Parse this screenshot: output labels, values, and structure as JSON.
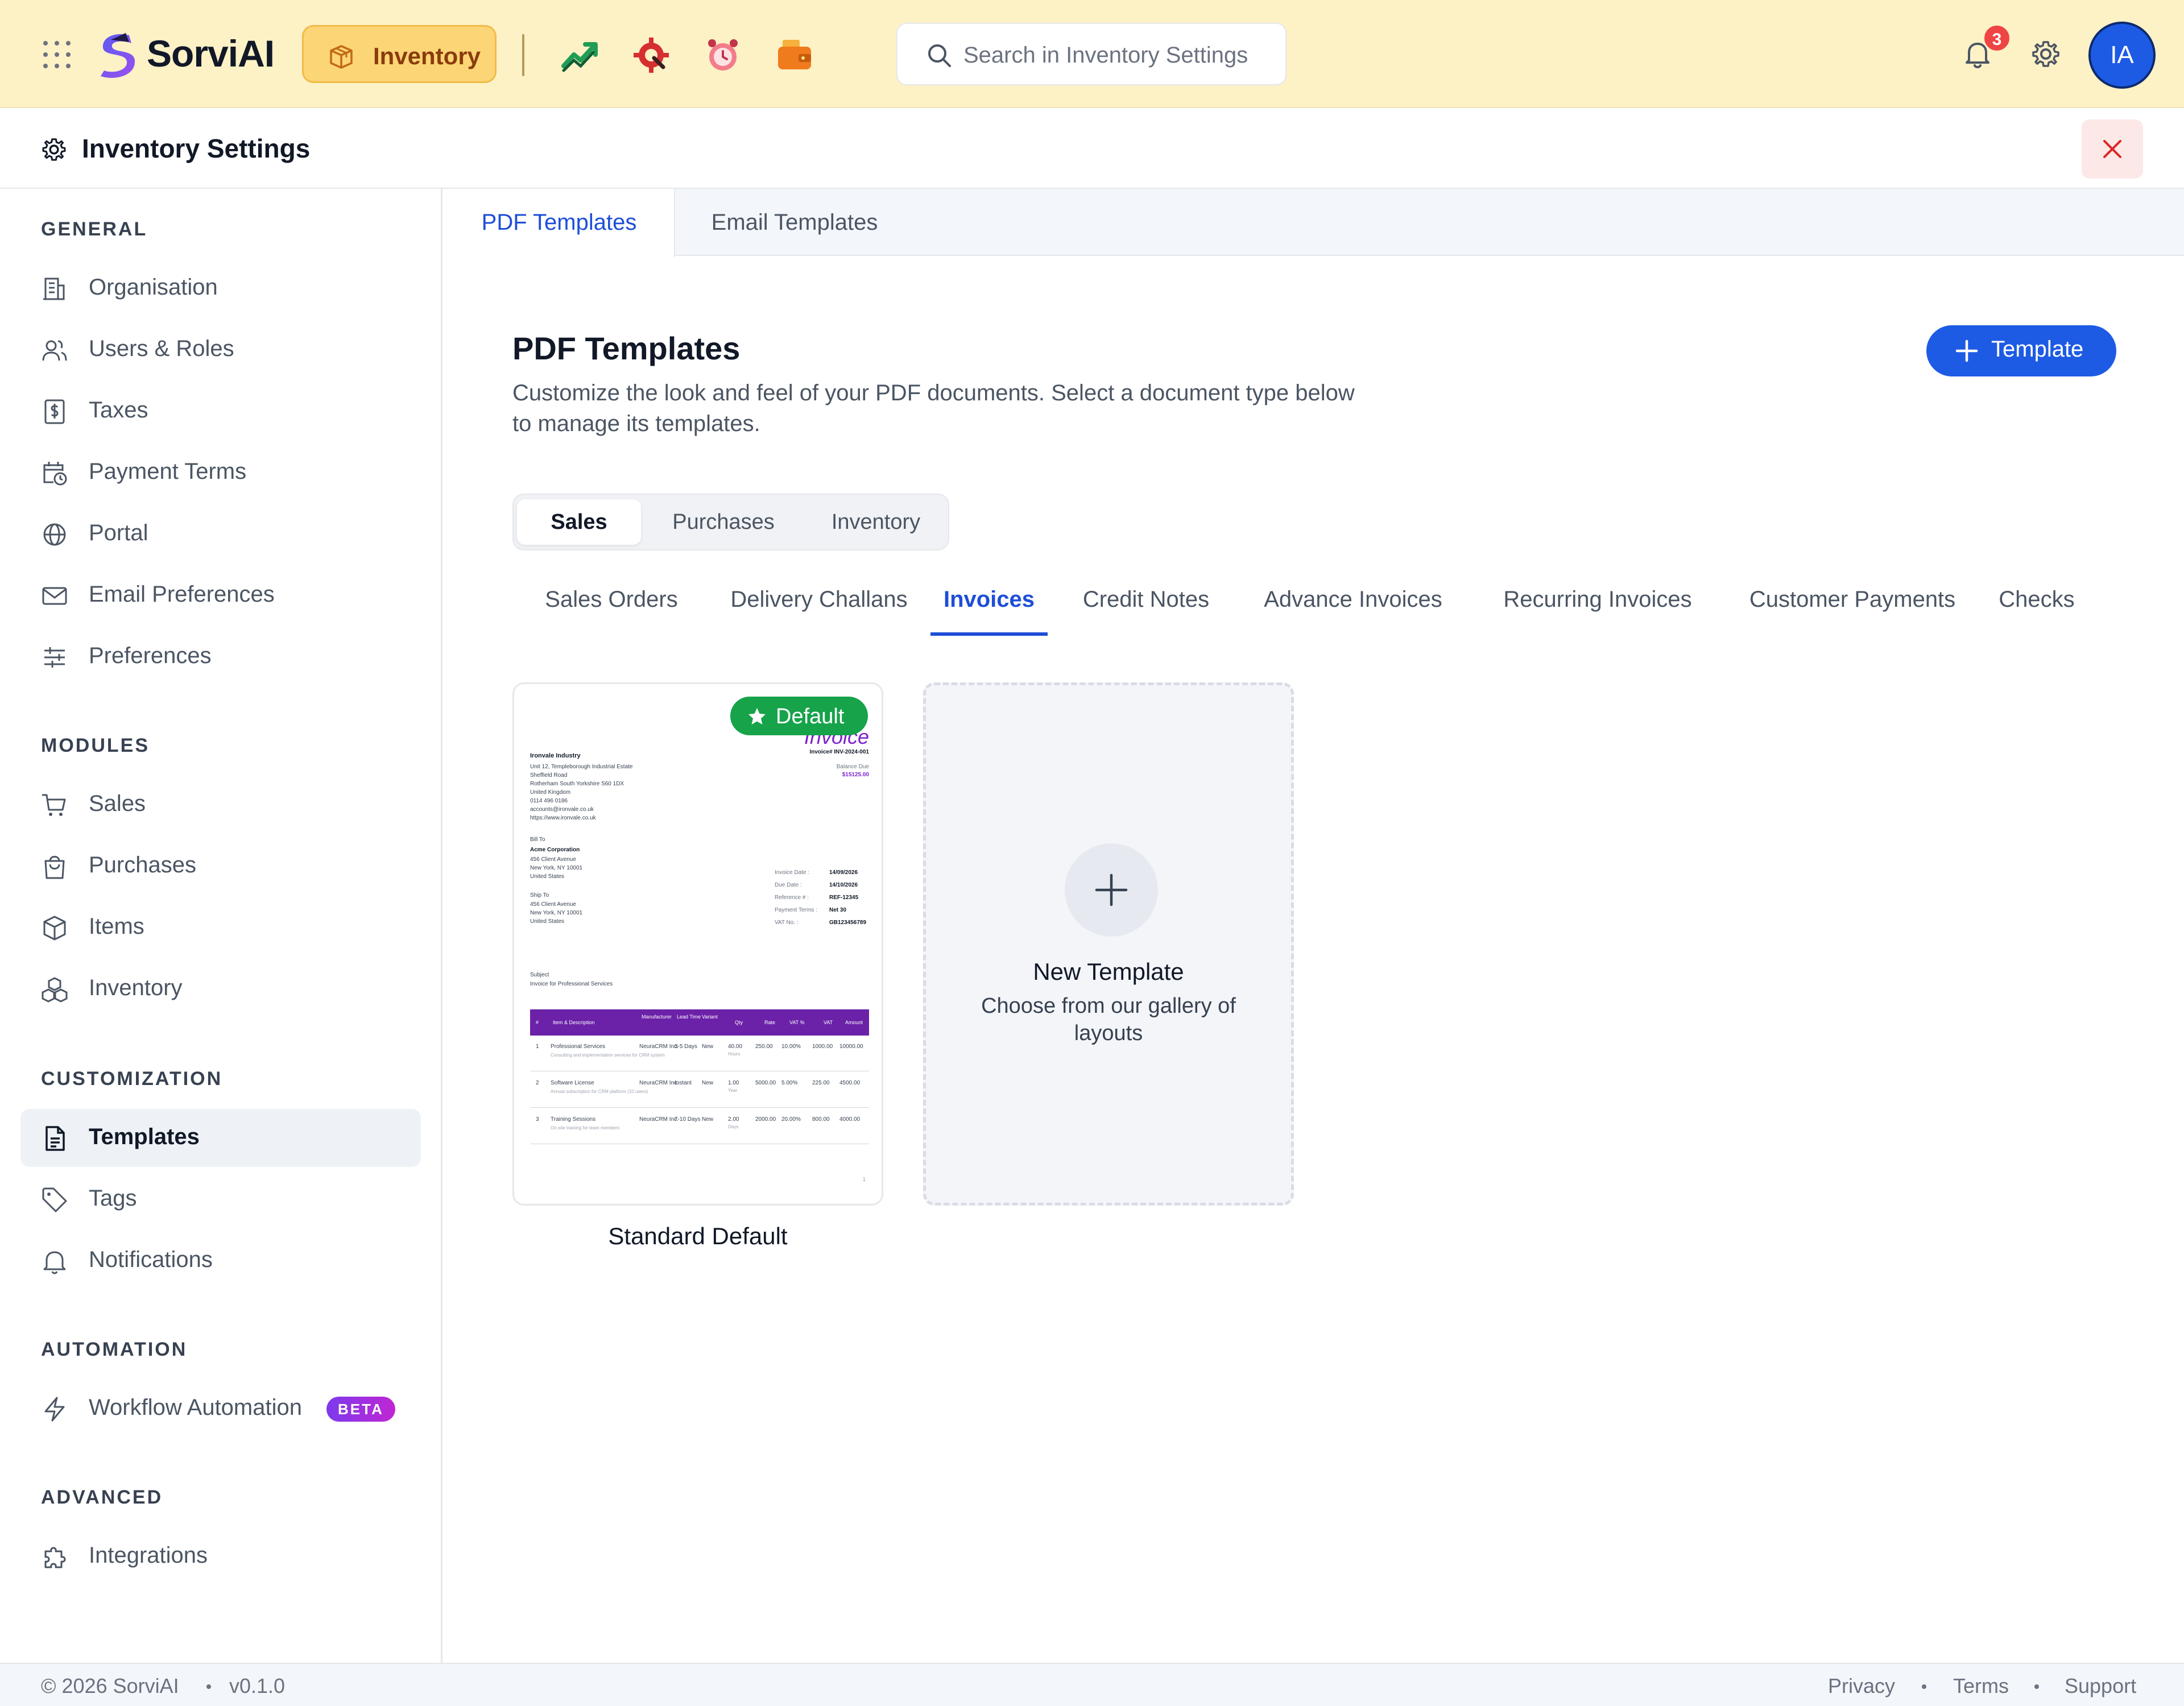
{
  "app": {
    "name": "SorviAI",
    "module": "Inventory"
  },
  "topbar": {
    "search_placeholder": "Search in Inventory Settings",
    "notifications_count": "3",
    "avatar_initials": "IA",
    "apps": [
      "analytics-icon",
      "service-gear-icon",
      "alarm-icon",
      "wallet-icon"
    ]
  },
  "header": {
    "title": "Inventory Settings"
  },
  "sidebar": {
    "sections": [
      {
        "heading": "GENERAL",
        "items": [
          "Organisation",
          "Users & Roles",
          "Taxes",
          "Payment Terms",
          "Portal",
          "Email Preferences",
          "Preferences"
        ]
      },
      {
        "heading": "MODULES",
        "items": [
          "Sales",
          "Purchases",
          "Items",
          "Inventory"
        ]
      },
      {
        "heading": "CUSTOMIZATION",
        "items": [
          "Templates",
          "Tags",
          "Notifications"
        ]
      },
      {
        "heading": "AUTOMATION",
        "items": [
          "Workflow Automation"
        ]
      },
      {
        "heading": "ADVANCED",
        "items": [
          "Integrations"
        ]
      }
    ],
    "active_item": "Templates",
    "beta_label": "BETA"
  },
  "main": {
    "top_tabs": [
      "PDF Templates",
      "Email Templates"
    ],
    "active_top_tab": "PDF Templates",
    "title": "PDF Templates",
    "description": "Customize the look and feel of your PDF documents. Select a document type below to manage its templates.",
    "add_button_label": "Template",
    "segments": [
      "Sales",
      "Purchases",
      "Inventory"
    ],
    "active_segment": "Sales",
    "doc_tabs": [
      "Sales Orders",
      "Delivery Challans",
      "Invoices",
      "Credit Notes",
      "Advance Invoices",
      "Recurring Invoices",
      "Customer Payments",
      "Checks"
    ],
    "active_doc_tab": "Invoices",
    "template_card": {
      "name": "Standard Default",
      "badge": "Default",
      "preview": {
        "doc_title": "Invoice",
        "invoice_no": "Invoice# INV-2024-001",
        "balance_label": "Balance Due",
        "balance_value": "$15125.00",
        "company": "Ironvale Industry",
        "address_lines": [
          "Unit 12, Templeborough Industrial Estate",
          "Sheffield Road",
          "Rotherham South Yorkshire S60 1DX",
          "United Kingdom",
          "0114 496 0186",
          "accounts@ironvale.co.uk",
          "https://www.ironvale.co.uk"
        ],
        "bill_to_label": "Bill To",
        "bill_to": [
          "Acme Corporation",
          "456 Client Avenue",
          "New York, NY 10001",
          "United States"
        ],
        "ship_to_label": "Ship To",
        "ship_to": [
          "456 Client Avenue",
          "New York, NY 10001",
          "United States"
        ],
        "meta": [
          {
            "k": "Invoice Date :",
            "v": "14/09/2026"
          },
          {
            "k": "Due Date :",
            "v": "14/10/2026"
          },
          {
            "k": "Reference # :",
            "v": "REF-12345"
          },
          {
            "k": "Payment Terms :",
            "v": "Net 30"
          },
          {
            "k": "VAT No. :",
            "v": "GB123456789"
          }
        ],
        "subject_label": "Subject",
        "subject": "Invoice for Professional Services",
        "columns": [
          "#",
          "Item & Description",
          "Manufacturer",
          "Lead Time",
          "Variant",
          "Qty",
          "Rate",
          "VAT %",
          "VAT",
          "Amount"
        ],
        "rows": [
          {
            "no": "1",
            "item": "Professional Services",
            "desc": "Consulting and implementation services for CRM system",
            "mfr": "NeuraCRM Inc.",
            "lead": "3-5 Days",
            "variant": "New",
            "qty": "40.00",
            "unit": "Hours",
            "rate": "250.00",
            "vat_pct": "10.00%",
            "vat": "1000.00",
            "amount": "10000.00"
          },
          {
            "no": "2",
            "item": "Software License",
            "desc": "Annual subscription for CRM platform (10 users)",
            "mfr": "NeuraCRM Inc.",
            "lead": "Instant",
            "variant": "New",
            "qty": "1.00",
            "unit": "Year",
            "rate": "5000.00",
            "vat_pct": "5.00%",
            "vat": "225.00",
            "amount": "4500.00"
          },
          {
            "no": "3",
            "item": "Training Sessions",
            "desc": "On-site training for team members",
            "mfr": "NeuraCRM Inc.",
            "lead": "7-10 Days",
            "variant": "New",
            "qty": "2.00",
            "unit": "Days",
            "rate": "2000.00",
            "vat_pct": "20.00%",
            "vat": "800.00",
            "amount": "4000.00"
          }
        ],
        "page_no": "1"
      }
    },
    "new_template": {
      "title": "New Template",
      "description": "Choose from our gallery of layouts"
    }
  },
  "footer": {
    "copyright": "© 2026 SorviAI",
    "version": "v0.1.0",
    "links": [
      "Privacy",
      "Terms",
      "Support"
    ]
  },
  "colors": {
    "topbar_bg": "#fdf1c6",
    "accent": "#1d5be4",
    "active_tab": "#1d4ed8",
    "default_badge": "#16a34a",
    "invoice_header": "#6b21a8",
    "beta_badge": "#9333ea",
    "notification_badge": "#ef4444"
  }
}
